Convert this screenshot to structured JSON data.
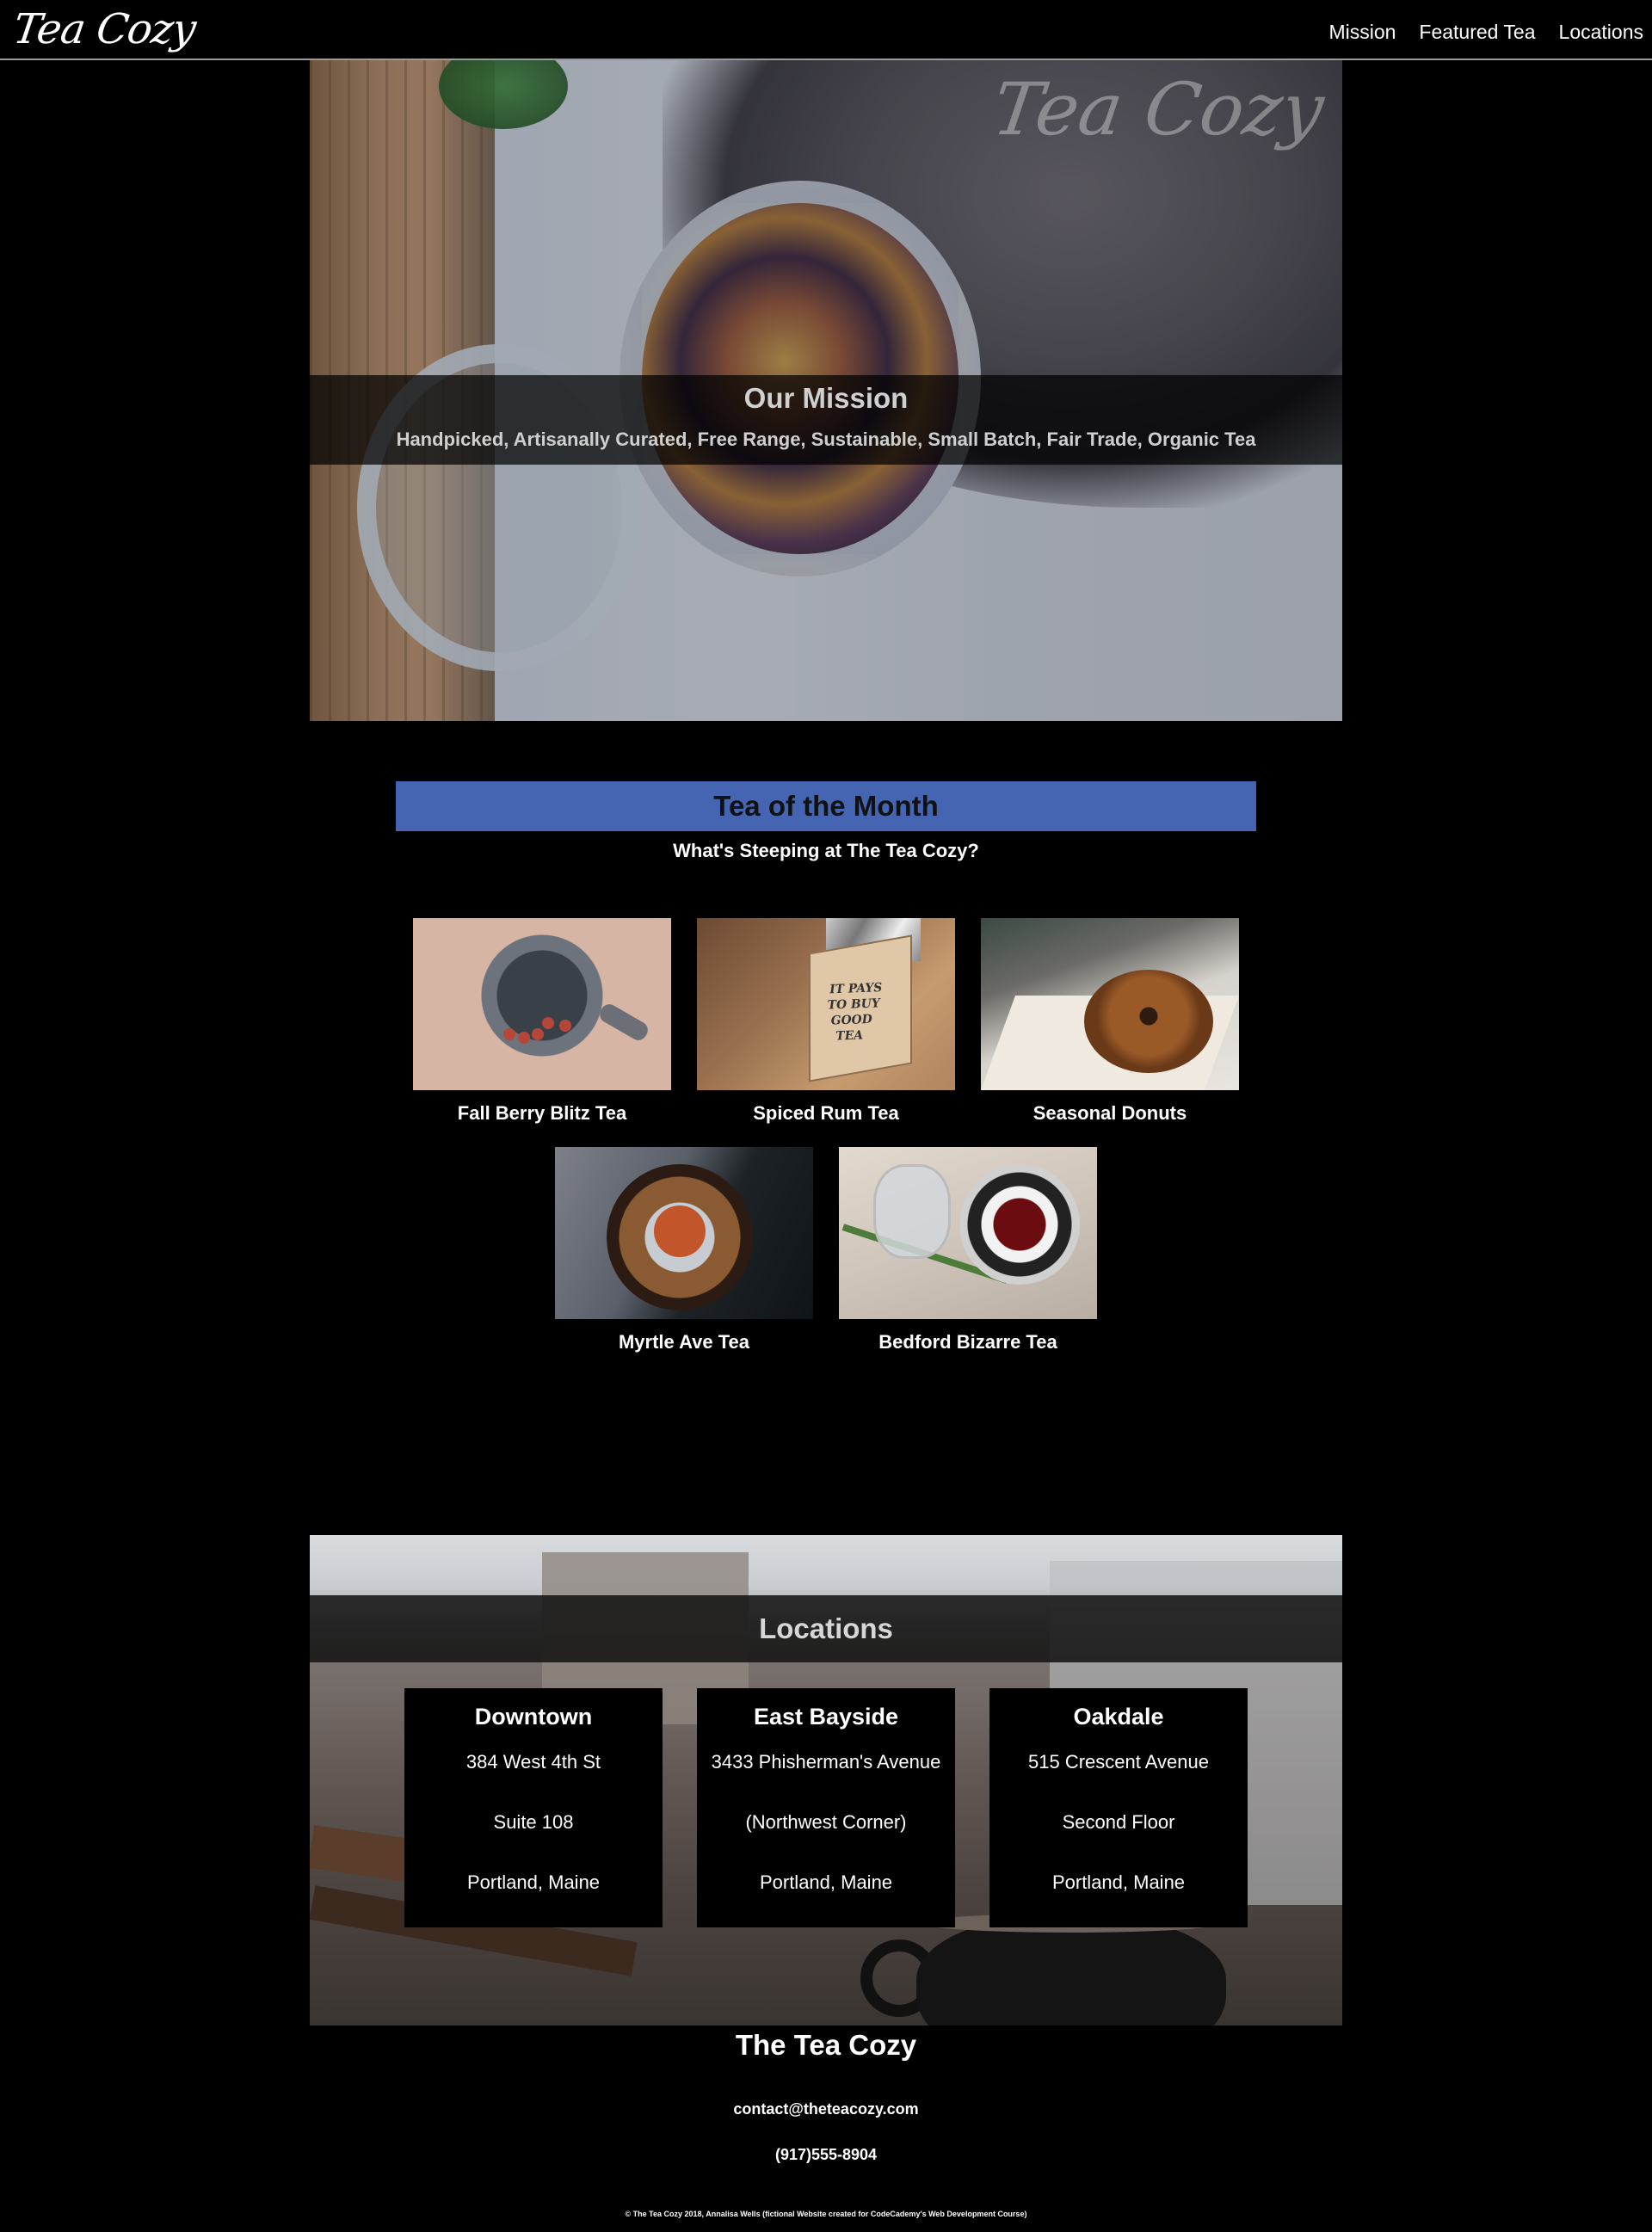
{
  "header": {
    "logo": "Tea Cozy",
    "nav": [
      "Mission",
      "Featured Tea",
      "Locations"
    ]
  },
  "hero": {
    "watermark": "Tea Cozy",
    "title": "Our Mission",
    "subtitle": "Handpicked, Artisanally Curated, Free Range, Sustainable, Small Batch, Fair Trade, Organic Tea"
  },
  "featured": {
    "title": "Tea of the Month",
    "subtitle": "What's Steeping at The Tea Cozy?",
    "items": [
      {
        "name": "Fall Berry Blitz Tea"
      },
      {
        "name": "Spiced Rum Tea"
      },
      {
        "name": "Seasonal Donuts"
      },
      {
        "name": "Myrtle Ave Tea"
      },
      {
        "name": "Bedford Bizarre Tea"
      }
    ],
    "box_text": "IT PAYS\nTO BUY\nGOOD\nTEA"
  },
  "locations": {
    "title": "Locations",
    "cards": [
      {
        "name": "Downtown",
        "lines": [
          "384 West 4th St",
          "Suite 108",
          "Portland, Maine"
        ]
      },
      {
        "name": "East Bayside",
        "lines": [
          "3433 Phisherman's Avenue",
          "(Northwest Corner)",
          "Portland, Maine"
        ]
      },
      {
        "name": "Oakdale",
        "lines": [
          "515 Crescent Avenue",
          "Second Floor",
          "Portland, Maine"
        ]
      }
    ]
  },
  "footer": {
    "title": "The Tea Cozy",
    "email": "contact@theteacozy.com",
    "phone": "(917)555-8904",
    "copyright": "© The Tea Cozy 2018, Annalisa Wells (fictional Website created for CodeCademy's Web Development Course)"
  },
  "colors": {
    "background": "#000000",
    "accent": "#4565b2"
  }
}
